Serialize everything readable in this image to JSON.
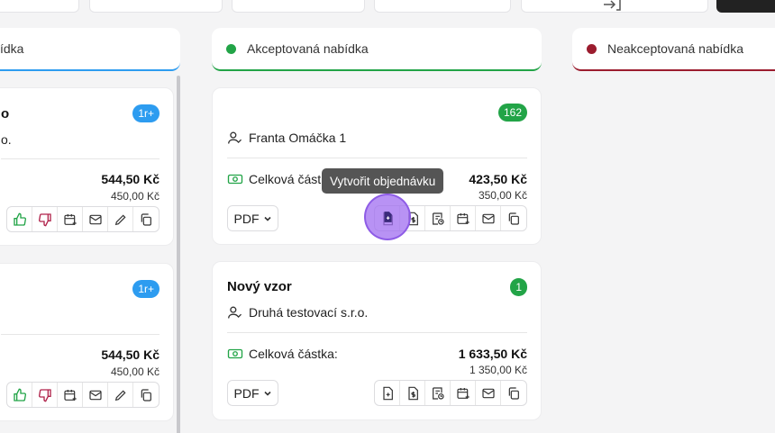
{
  "columns": [
    {
      "label": "ídka",
      "accent": "#2d9cf0"
    },
    {
      "label": "Akceptovaná nabídka",
      "accent": "#22a447"
    },
    {
      "label": "Neakceptovaná nabídka",
      "accent": "#9b1c2e"
    }
  ],
  "left_cards": [
    {
      "title": "o",
      "person": "o.",
      "badge": "1r+",
      "amount": "544,50 Kč",
      "subamount": "450,00 Kč"
    },
    {
      "badge": "1r+",
      "amount": "544,50 Kč",
      "subamount": "450,00 Kč"
    }
  ],
  "accepted_cards": [
    {
      "badge": "162",
      "person": "Franta Omáčka 1",
      "total_label": "Celková část",
      "amount": "423,50 Kč",
      "subamount": "350,00 Kč",
      "pdf_label": "PDF"
    },
    {
      "title": "Nový vzor",
      "badge": "1",
      "person": "Druhá testovací s.r.o.",
      "total_label": "Celková částka:",
      "amount": "1 633,50 Kč",
      "subamount": "1 350,00 Kč",
      "pdf_label": "PDF"
    }
  ],
  "tooltip": "Vytvořit objednávku",
  "icons": {
    "approve": "thumbs-up-icon",
    "reject": "thumbs-down-icon",
    "calendar": "calendar-plus-icon",
    "mail": "mail-icon",
    "edit": "pencil-icon",
    "copy": "copy-icon",
    "create_order": "file-plus-icon",
    "invoice": "file-dollar-icon",
    "history": "file-history-icon"
  }
}
